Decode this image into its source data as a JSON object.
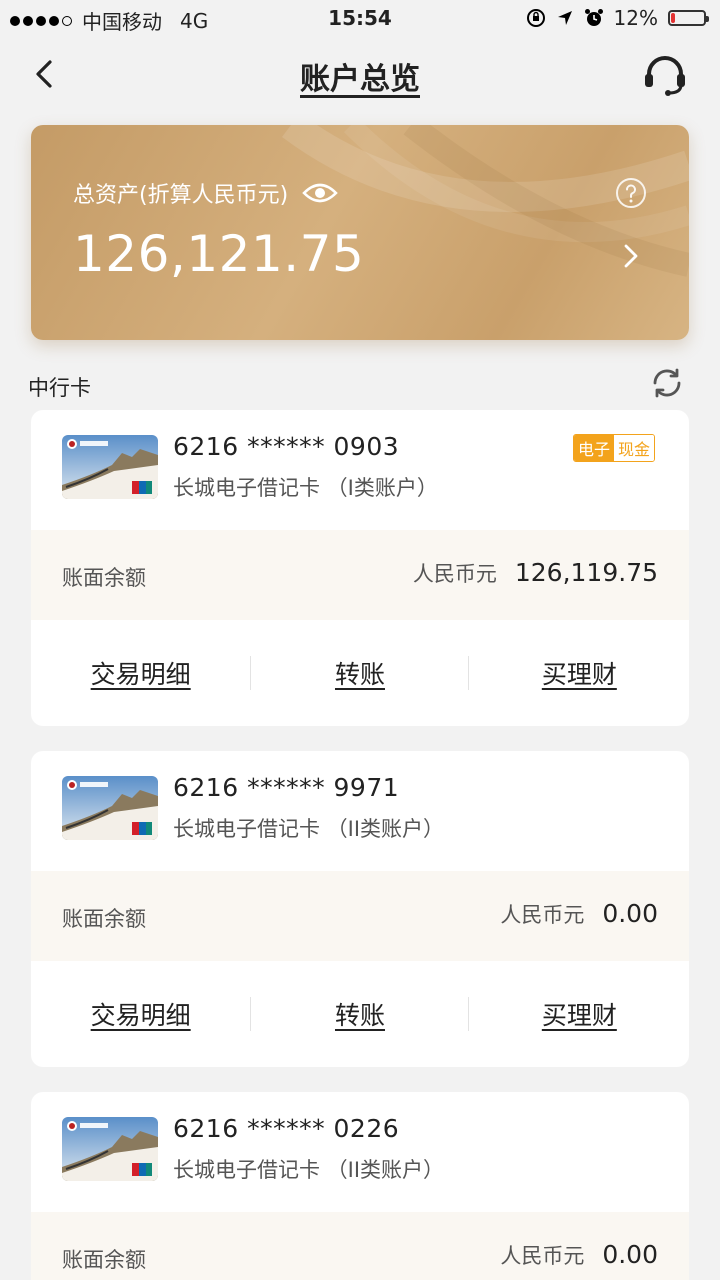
{
  "status_bar": {
    "carrier": "中国移动",
    "network": "4G",
    "time": "15:54",
    "battery": "12%",
    "battery_level": 0.12
  },
  "nav": {
    "title": "账户总览"
  },
  "assets": {
    "label": "总资产(折算人民币元)",
    "value": "126,121.75"
  },
  "section": {
    "title": "中行卡"
  },
  "cards": [
    {
      "number": "6216 ****** 0903",
      "name": "长城电子借记卡 （I类账户）",
      "tag_left": "电子",
      "tag_right": "现金",
      "balance_label": "账面余额",
      "currency": "人民币元",
      "balance": "126,119.75",
      "actions": [
        "交易明细",
        "转账",
        "买理财"
      ]
    },
    {
      "number": "6216 ****** 9971",
      "name": "长城电子借记卡 （II类账户）",
      "balance_label": "账面余额",
      "currency": "人民币元",
      "balance": "0.00",
      "actions": [
        "交易明细",
        "转账",
        "买理财"
      ]
    },
    {
      "number": "6216 ****** 0226",
      "name": "长城电子借记卡 （II类账户）",
      "balance_label": "账面余额",
      "currency": "人民币元",
      "balance": "0.00"
    }
  ],
  "colors": {
    "gold": "#c9a06b",
    "tag_orange": "#f3a31c",
    "battery_red": "#e33333"
  }
}
